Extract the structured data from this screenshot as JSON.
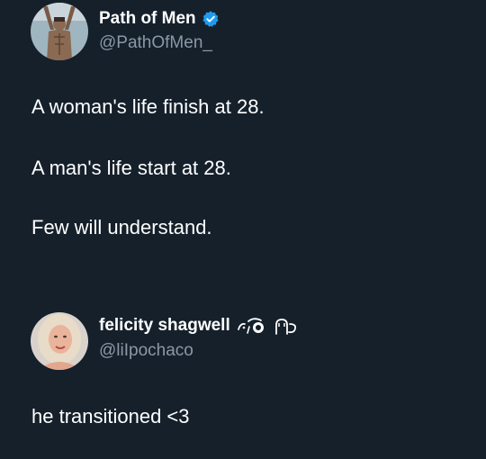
{
  "posts": [
    {
      "author": {
        "display_name": "Path of Men",
        "handle": "@PathOfMen_",
        "verified": true,
        "verified_color": "#1d9bf0",
        "avatar_icon": "muscular-man-avatar"
      },
      "text_lines": [
        "A woman's life finish at 28.",
        "A man's life start at 28.",
        "Few will understand."
      ]
    },
    {
      "author": {
        "display_name": "felicity shagwell",
        "handle": "@liIpochaco",
        "verified": false,
        "avatar_icon": "woman-portrait-avatar",
        "name_emoji": [
          "crying-face-emoji",
          "pleading-emoji"
        ]
      },
      "text_lines": [
        "he transitioned <3"
      ]
    }
  ],
  "colors": {
    "background": "#15202b",
    "primary_text": "#ffffff",
    "secondary_text": "#8b98a5"
  }
}
